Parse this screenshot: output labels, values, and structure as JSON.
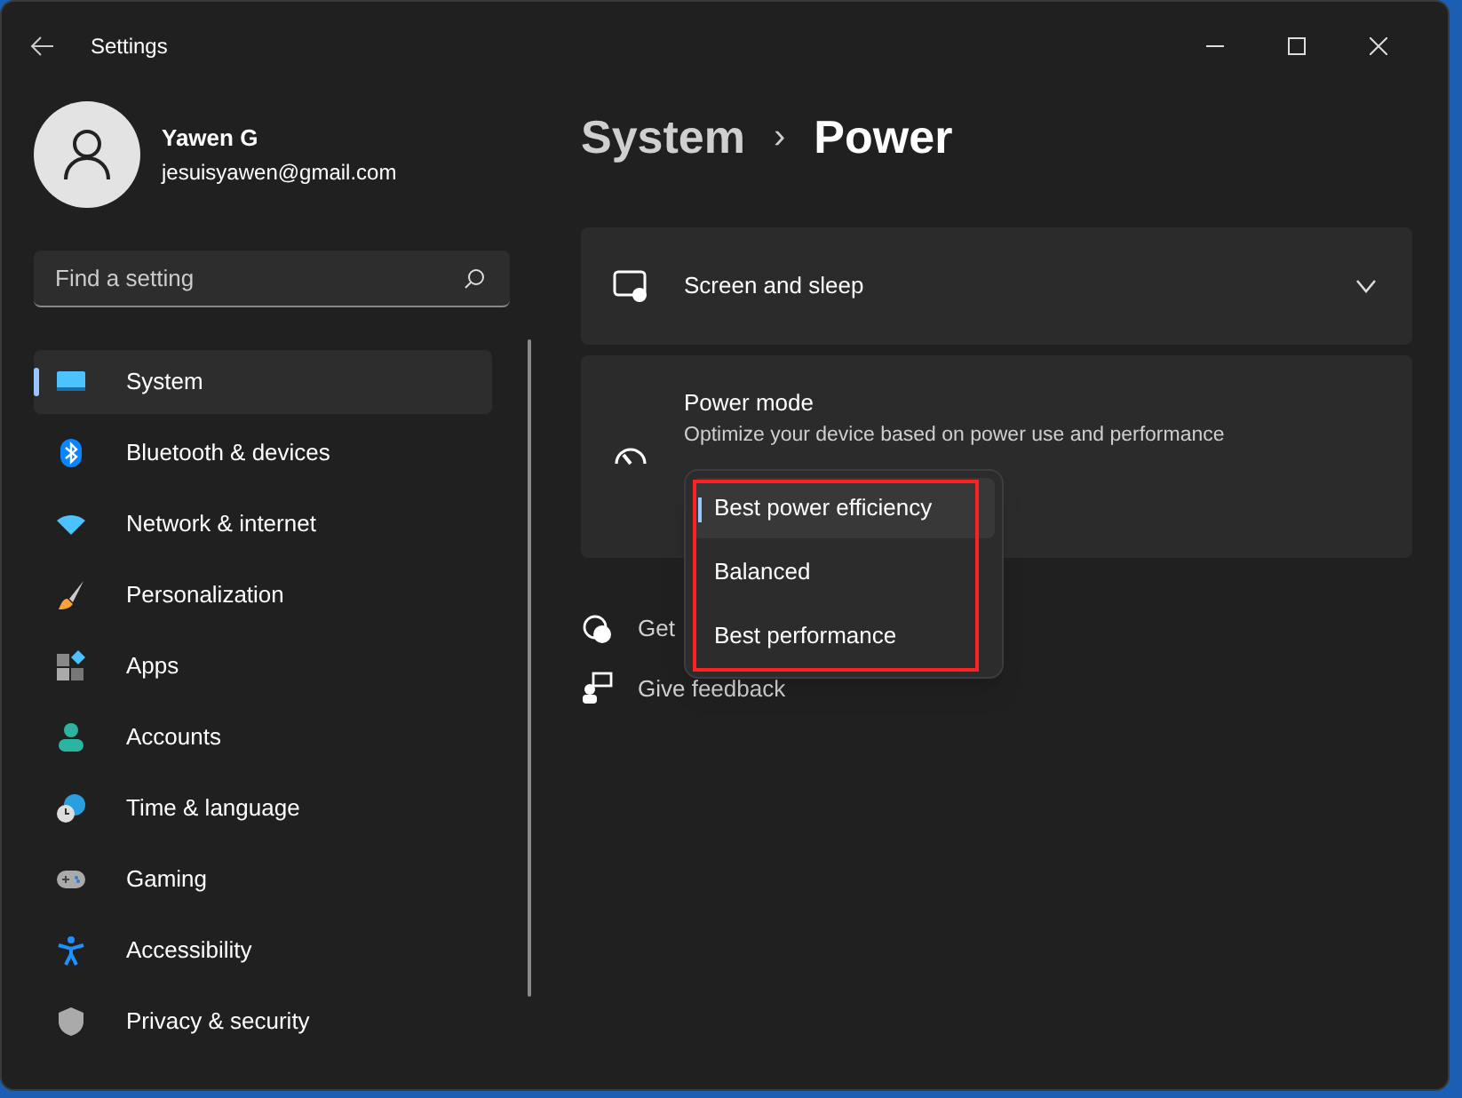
{
  "window": {
    "title": "Settings"
  },
  "profile": {
    "name": "Yawen G",
    "email": "jesuisyawen@gmail.com"
  },
  "search": {
    "placeholder": "Find a setting"
  },
  "sidebar": {
    "items": [
      {
        "label": "System",
        "selected": true
      },
      {
        "label": "Bluetooth & devices",
        "selected": false
      },
      {
        "label": "Network & internet",
        "selected": false
      },
      {
        "label": "Personalization",
        "selected": false
      },
      {
        "label": "Apps",
        "selected": false
      },
      {
        "label": "Accounts",
        "selected": false
      },
      {
        "label": "Time & language",
        "selected": false
      },
      {
        "label": "Gaming",
        "selected": false
      },
      {
        "label": "Accessibility",
        "selected": false
      },
      {
        "label": "Privacy & security",
        "selected": false
      }
    ]
  },
  "breadcrumb": {
    "parent": "System",
    "separator": "›",
    "current": "Power"
  },
  "cards": [
    {
      "kind": "expander",
      "title": "Screen and sleep",
      "expanded": false
    },
    {
      "kind": "dropdown",
      "title": "Power mode",
      "description": "Optimize your device based on power use and performance",
      "options": [
        {
          "label": "Best power efficiency",
          "selected": true
        },
        {
          "label": "Balanced",
          "selected": false
        },
        {
          "label": "Best performance",
          "selected": false
        }
      ]
    }
  ],
  "links": [
    {
      "label": "Get"
    },
    {
      "label": "Give feedback"
    }
  ]
}
